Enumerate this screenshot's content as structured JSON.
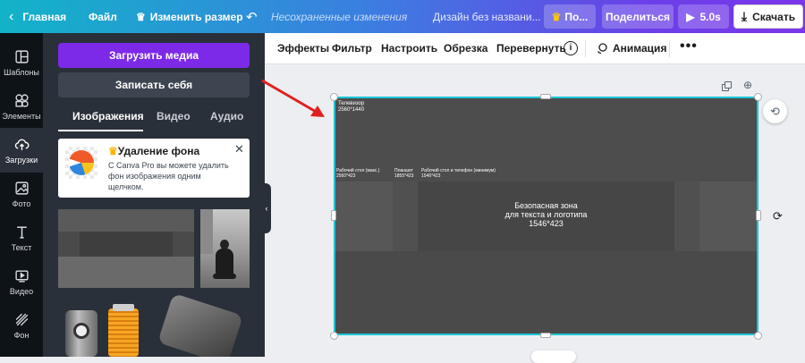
{
  "topbar": {
    "home": "Главная",
    "file": "Файл",
    "resize": "Изменить размер",
    "unsaved": "Несохраненные изменения",
    "design_title": "Дизайн без названи...",
    "pro_label": "По...",
    "share": "Поделиться",
    "duration": "5.0s",
    "download": "Скачать"
  },
  "rail": [
    {
      "label": "Шаблоны",
      "icon": "layout-icon"
    },
    {
      "label": "Элементы",
      "icon": "shapes-icon"
    },
    {
      "label": "Загрузки",
      "icon": "upload-cloud-icon"
    },
    {
      "label": "Фото",
      "icon": "photo-icon"
    },
    {
      "label": "Текст",
      "icon": "text-icon"
    },
    {
      "label": "Видео",
      "icon": "video-icon"
    },
    {
      "label": "Фон",
      "icon": "background-icon"
    }
  ],
  "panel": {
    "upload_media": "Загрузить медиа",
    "record_self": "Записать себя",
    "tabs": [
      "Изображения",
      "Видео",
      "Аудио"
    ],
    "promo": {
      "title": "Удаление фона",
      "text_line1": "С Canva Pro вы можете удалить",
      "text_line2": "фон изображения одним",
      "text_line3": "щелчком."
    }
  },
  "toolbar": {
    "effects": "Эффекты",
    "filter": "Фильтр",
    "adjust": "Настроить",
    "crop": "Обрезка",
    "flip": "Перевернуть",
    "animation": "Анимация"
  },
  "canvas": {
    "tv_label": "Телевизор",
    "tv_size": "2560*1440",
    "desktop_label": "Рабочий стол (макс.)",
    "desktop_size": "2560*423",
    "tablet_label": "Планшет",
    "tablet_size": "1855*423",
    "mobile_label": "Рабочий стол и телефон (минимум)",
    "mobile_size": "1546*423",
    "safe_line1": "Безопасная зона",
    "safe_line2": "для текста и логотипа",
    "safe_size": "1546*423"
  },
  "colors": {
    "accent": "#7d2ae8",
    "selection": "#19c6d4",
    "arrow": "#e02020"
  }
}
